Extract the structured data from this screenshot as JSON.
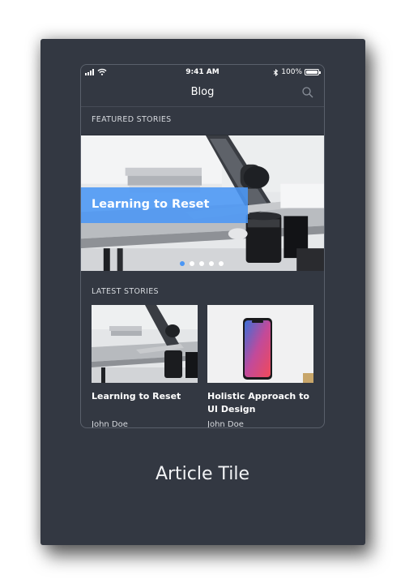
{
  "status_bar": {
    "time": "9:41 AM",
    "battery": "100%"
  },
  "nav": {
    "title": "Blog",
    "search_icon": "search-icon"
  },
  "featured": {
    "section_label": "FEATURED STORIES",
    "title": "Learning to Reset",
    "active_slide": 1,
    "slide_count": 5
  },
  "latest": {
    "section_label": "LATEST STORIES",
    "stories": [
      {
        "title": "Learning to Reset",
        "author": "John Doe"
      },
      {
        "title": "Holistic Approach to UI Design",
        "author": "John Doe"
      }
    ]
  },
  "caption": "Article Tile",
  "colors": {
    "background": "#333842",
    "accent": "#4a96f5",
    "text": "#ffffff"
  }
}
